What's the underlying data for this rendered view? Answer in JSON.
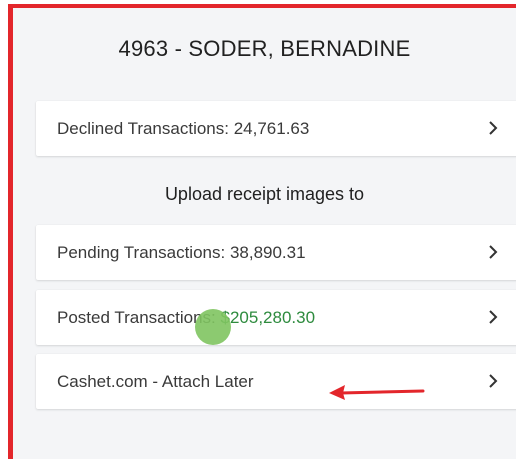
{
  "header": {
    "title": "4963 - SODER, BERNADINE"
  },
  "rows": {
    "declined": {
      "label": "Declined Transactions: 24,761.63"
    },
    "section_heading": "Upload receipt images to",
    "pending": {
      "label": "Pending Transactions: 38,890.31"
    },
    "posted": {
      "label_prefix": "Posted Transa",
      "label_hidden": "ctio",
      "label_suffix": "ns: ",
      "value": "$205,280.30"
    },
    "cashet": {
      "label": "Cashet.com - Attach Later"
    }
  },
  "icons": {
    "chevron": "chevron-right-icon",
    "annotation_arrow": "red-arrow-icon"
  },
  "colors": {
    "highlight_border": "#e3262b",
    "positive_value": "#2e8b3e",
    "touch_indicator": "#80c460",
    "background": "#f4f5f7"
  }
}
